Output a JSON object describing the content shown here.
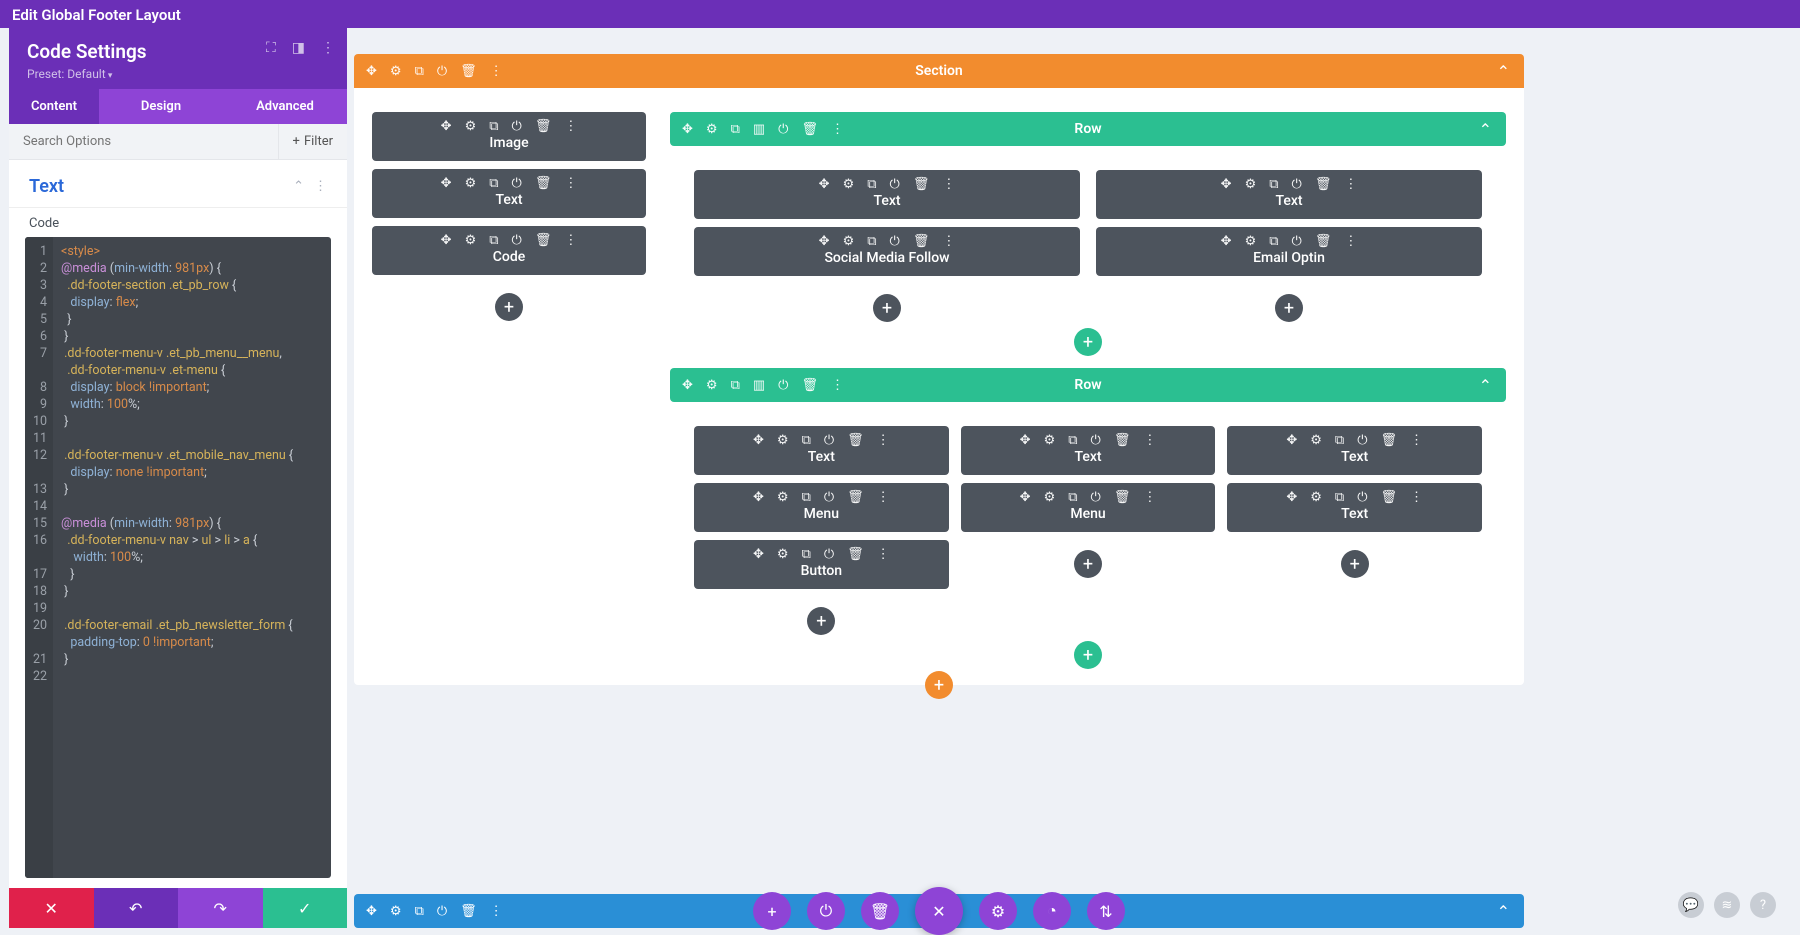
{
  "header": {
    "title": "Edit Global Footer Layout"
  },
  "panel": {
    "title": "Code Settings",
    "preset": "Preset: Default",
    "tabs": {
      "content": "Content",
      "design": "Design",
      "advanced": "Advanced",
      "active": "content"
    },
    "search_placeholder": "Search Options",
    "filter_label": "Filter",
    "toggle_title": "Text",
    "code_label": "Code"
  },
  "code_lines": [
    "<style>",
    "@media (min-width: 981px) {",
    "  .dd-footer-section .et_pb_row {",
    "   display: flex;",
    "  }",
    " }",
    " .dd-footer-menu-v .et_pb_menu__menu,",
    "  .dd-footer-menu-v .et-menu {",
    "   display: block !important;",
    "   width: 100%;",
    " }",
    "",
    " .dd-footer-menu-v .et_mobile_nav_menu {",
    "   display: none !important;",
    " }",
    "",
    "@media (min-width: 981px) {",
    "  .dd-footer-menu-v nav > ul > li > a {",
    "    width: 100%;",
    "   }",
    " }",
    "",
    " .dd-footer-email .et_pb_newsletter_form {",
    "   padding-top: 0 !important;",
    " }",
    ""
  ],
  "section": {
    "label": "Section"
  },
  "row_label": "Row",
  "modules": {
    "image": "Image",
    "text": "Text",
    "code": "Code",
    "social": "Social Media Follow",
    "email": "Email Optin",
    "menu": "Menu",
    "button": "Button"
  },
  "colors": {
    "purple": "#6b2fb7",
    "purple_light": "#8e44d6",
    "orange": "#f28c2e",
    "teal": "#2bbf91",
    "slate": "#4d545d",
    "blue": "#2a8fd6",
    "red": "#e0214b"
  }
}
